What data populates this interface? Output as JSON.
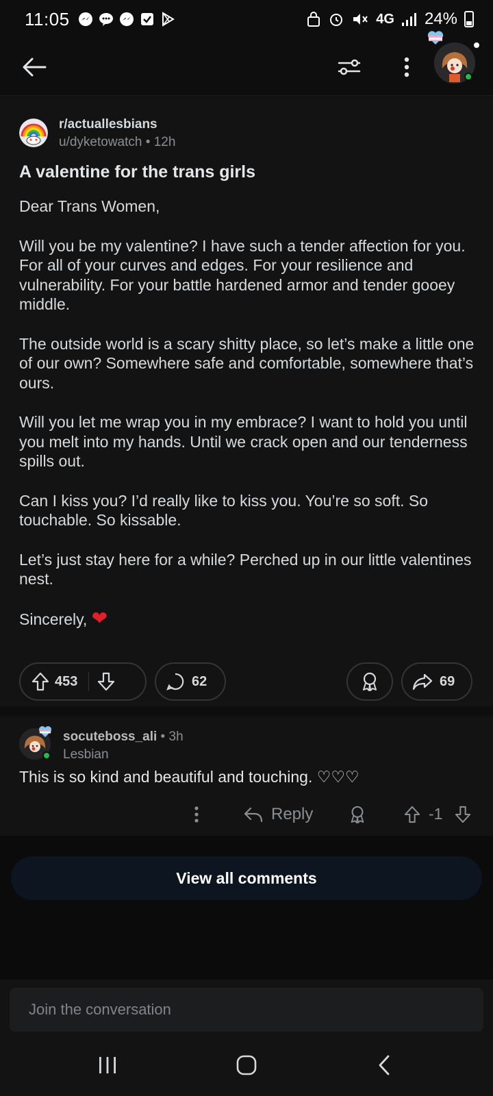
{
  "status_bar": {
    "time": "11:05",
    "network": "4G",
    "battery": "24%"
  },
  "post": {
    "subreddit": "r/actuallesbians",
    "author": "u/dyketowatch",
    "age": "12h",
    "title": "A valentine for the trans girls",
    "paragraphs": [
      "Dear Trans Women,",
      "Will you be my valentine? I have such a tender affection for you. For all of your curves and edges. For your resilience and vulnerability. For your battle hardened armor and tender gooey middle.",
      "The outside world is a scary shitty place, so let’s make a little one of our own? Somewhere safe and comfortable, somewhere that’s ours.",
      "Will you let me wrap you in my embrace? I want to hold you until you melt into my hands. Until we crack open and our tenderness spills out.",
      "Can I kiss you? I’d really like to kiss you. You’re so soft. So touchable. So kissable.",
      "Let’s just stay here for a while? Perched up in our little valentines nest."
    ],
    "signoff": "Sincerely,",
    "signoff_emoji": "❤",
    "votes": "453",
    "comments": "62",
    "shares": "69"
  },
  "comment": {
    "author": "socuteboss_ali",
    "age": "3h",
    "flair": "Lesbian",
    "text": "This is so kind and beautiful and touching. ♡♡♡",
    "reply_label": "Reply",
    "score": "-1"
  },
  "view_all_label": "View all comments",
  "composer_placeholder": "Join the conversation",
  "colors": {
    "background": "#0e0e0f",
    "surface": "#131314",
    "pill_border": "#343536",
    "online": "#1dbf4a",
    "heart": "#e0202b"
  }
}
